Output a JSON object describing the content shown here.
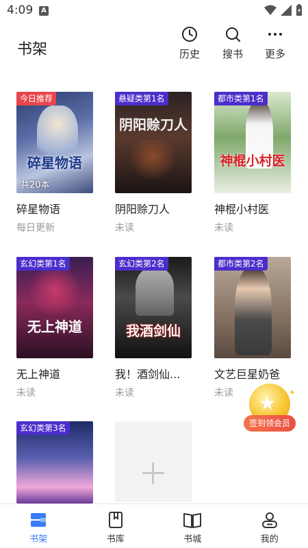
{
  "status_bar": {
    "time": "4:09",
    "notif_letter": "A"
  },
  "header": {
    "title": "书架",
    "actions": [
      {
        "label": "历史",
        "icon": "clock-icon"
      },
      {
        "label": "搜书",
        "icon": "search-icon"
      },
      {
        "label": "更多",
        "icon": "more-dots-icon"
      }
    ]
  },
  "books": [
    {
      "title": "碎星物语",
      "status": "每日更新",
      "badge": "今日推荐",
      "badge_color": "#e8454b",
      "cover_count": "共20本",
      "cover_text": "碎星物语"
    },
    {
      "title": "阴阳赊刀人",
      "status": "未读",
      "badge": "悬疑类第1名",
      "badge_color": "#4b2ecb",
      "cover_text": "阴阳赊刀人"
    },
    {
      "title": "神棍小村医",
      "status": "未读",
      "badge": "都市类第1名",
      "badge_color": "#4b2ecb",
      "cover_text": "神棍小村医"
    },
    {
      "title": "无上神道",
      "status": "未读",
      "badge": "玄幻类第1名",
      "badge_color": "#4b2ecb",
      "cover_text": "无上神道"
    },
    {
      "title": "我！酒剑仙...",
      "status": "未读",
      "badge": "玄幻类第2名",
      "badge_color": "#4b2ecb",
      "cover_text": "我酒剑仙"
    },
    {
      "title": "文艺巨星奶爸",
      "status": "未读",
      "badge": "都市类第2名",
      "badge_color": "#4b2ecb",
      "cover_text": ""
    },
    {
      "title": "",
      "status": "",
      "badge": "玄幻类第3名",
      "badge_color": "#4b2ecb",
      "cover_text": ""
    }
  ],
  "reward": {
    "label": "签到领会员"
  },
  "bottom_nav": [
    {
      "label": "书架",
      "icon": "bookshelf-icon",
      "active": true
    },
    {
      "label": "书库",
      "icon": "library-icon",
      "active": false
    },
    {
      "label": "书城",
      "icon": "bookstore-icon",
      "active": false
    },
    {
      "label": "我的",
      "icon": "profile-icon",
      "active": false
    }
  ],
  "colors": {
    "accent": "#3a7cf5",
    "badge_purple": "#4b2ecb",
    "badge_red": "#e8454b"
  }
}
